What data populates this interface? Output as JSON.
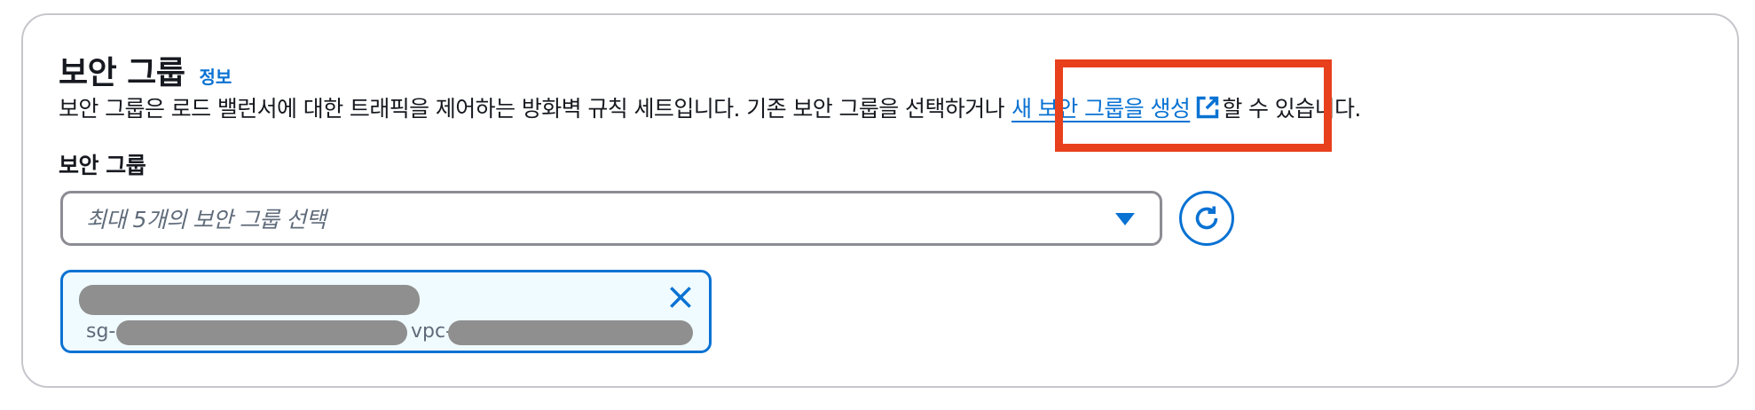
{
  "section": {
    "title": "보안 그룹",
    "info_link": "정보",
    "description_prefix": "보안 그룹은 로드 밸런서에 대한 트래픽을 제어하는 방화벽 규칙 세트입니다. 기존 보안 그룹을 선택하거나",
    "create_link": "새 보안 그룹을 생성",
    "description_suffix": "할 수 있습니다."
  },
  "field": {
    "label": "보안 그룹",
    "placeholder": "최대 5개의 보안 그룹 선택"
  },
  "selected_token": {
    "sg_prefix": "sg-",
    "vpc_prefix": "vpc-"
  },
  "colors": {
    "accent": "#0972d3",
    "highlight": "#e8401c",
    "redaction": "#8f8f8f"
  },
  "icons": {
    "external": "external-link-icon",
    "refresh": "refresh-icon",
    "dropdown": "caret-down-icon",
    "remove": "close-icon"
  }
}
